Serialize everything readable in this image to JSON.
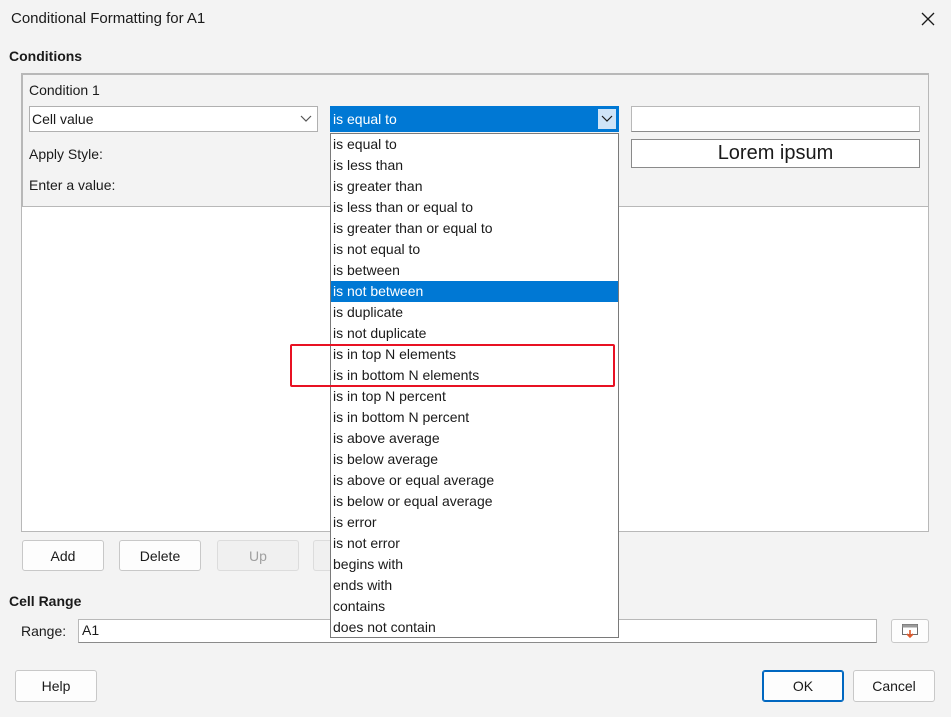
{
  "window": {
    "title": "Conditional Formatting for A1"
  },
  "conditions": {
    "section_label": "Conditions",
    "condition_label": "Condition 1",
    "type_combo": {
      "value": "Cell value"
    },
    "operator_combo": {
      "value": "is equal to"
    },
    "value_input": {
      "value": ""
    },
    "apply_style_label": "Apply Style:",
    "enter_value_label": "Enter a value:",
    "style_preview": "Lorem ipsum"
  },
  "operator_dropdown": {
    "items": [
      "is equal to",
      "is less than",
      "is greater than",
      "is less than or equal to",
      "is greater than or equal to",
      "is not equal to",
      "is between",
      "is not between",
      "is duplicate",
      "is not duplicate",
      "is in top N elements",
      "is in bottom N elements",
      "is in top N percent",
      "is in bottom N percent",
      "is above average",
      "is below average",
      "is above or equal average",
      "is below or equal average",
      "is error",
      "is not error",
      "begins with",
      "ends with",
      "contains",
      "does not contain"
    ],
    "selected_index": 7
  },
  "buttons": {
    "add": "Add",
    "delete": "Delete",
    "up": "Up"
  },
  "cell_range": {
    "section_label": "Cell Range",
    "range_label": "Range:",
    "range_value": "A1"
  },
  "footer": {
    "help": "Help",
    "ok": "OK",
    "cancel": "Cancel"
  },
  "colors": {
    "accent": "#0078d4",
    "highlight_box": "#e81123"
  }
}
